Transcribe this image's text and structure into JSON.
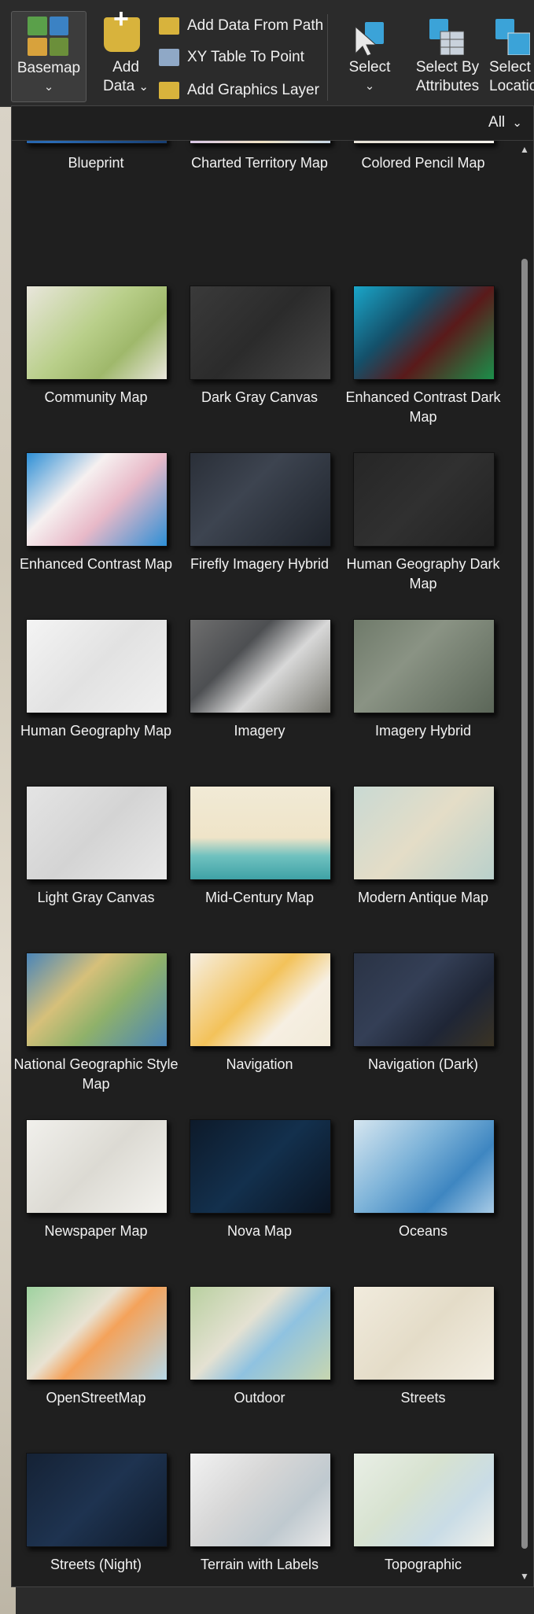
{
  "ribbon": {
    "basemap": {
      "label": "Basemap",
      "chevron": "⌄"
    },
    "add_data": {
      "label_line1": "Add",
      "label_line2": "Data",
      "chevron": "⌄"
    },
    "small_items": [
      {
        "label": "Add Data From Path"
      },
      {
        "label": "XY Table To Point"
      },
      {
        "label": "Add Graphics Layer"
      }
    ],
    "select": {
      "label": "Select",
      "chevron": "⌄"
    },
    "select_by_attributes": {
      "label_line1": "Select By",
      "label_line2": "Attributes"
    },
    "select_by_location": {
      "label_line1": "Select B",
      "label_line2": "Locatio"
    }
  },
  "gallery": {
    "filter": {
      "label": "All",
      "chevron": "⌄"
    },
    "tiles": [
      {
        "label": "Blueprint",
        "style": "blueprint"
      },
      {
        "label": "Charted Territory Map",
        "style": "charted"
      },
      {
        "label": "Colored Pencil Map",
        "style": "pencil"
      },
      {
        "label": "Community Map",
        "style": "community"
      },
      {
        "label": "Dark Gray Canvas",
        "style": "darkgray"
      },
      {
        "label": "Enhanced Contrast Dark Map",
        "style": "ecdark"
      },
      {
        "label": "Enhanced Contrast Map",
        "style": "ec"
      },
      {
        "label": "Firefly Imagery Hybrid",
        "style": "firefly"
      },
      {
        "label": "Human Geography Dark Map",
        "style": "hgdark"
      },
      {
        "label": "Human Geography Map",
        "style": "hg"
      },
      {
        "label": "Imagery",
        "style": "imagery"
      },
      {
        "label": "Imagery Hybrid",
        "style": "imageryhybrid"
      },
      {
        "label": "Light Gray Canvas",
        "style": "lightgray"
      },
      {
        "label": "Mid-Century Map",
        "style": "midcentury"
      },
      {
        "label": "Modern Antique Map",
        "style": "antique"
      },
      {
        "label": "National Geographic Style Map",
        "style": "natgeo"
      },
      {
        "label": "Navigation",
        "style": "navigation"
      },
      {
        "label": "Navigation (Dark)",
        "style": "navdark"
      },
      {
        "label": "Newspaper Map",
        "style": "newspaper"
      },
      {
        "label": "Nova Map",
        "style": "nova"
      },
      {
        "label": "Oceans",
        "style": "oceans"
      },
      {
        "label": "OpenStreetMap",
        "style": "osm"
      },
      {
        "label": "Outdoor",
        "style": "outdoor"
      },
      {
        "label": "Streets",
        "style": "streets"
      },
      {
        "label": "Streets (Night)",
        "style": "streetsnight"
      },
      {
        "label": "Terrain with Labels",
        "style": "terrain"
      },
      {
        "label": "Topographic",
        "style": "topo"
      }
    ]
  },
  "colors": {
    "ribbon_bg": "#2b2b2b",
    "panel_bg": "#1f1f1f",
    "text": "#f2f2f2",
    "accent_gold": "#d8b33c",
    "accent_blue": "#3ba3d8"
  }
}
